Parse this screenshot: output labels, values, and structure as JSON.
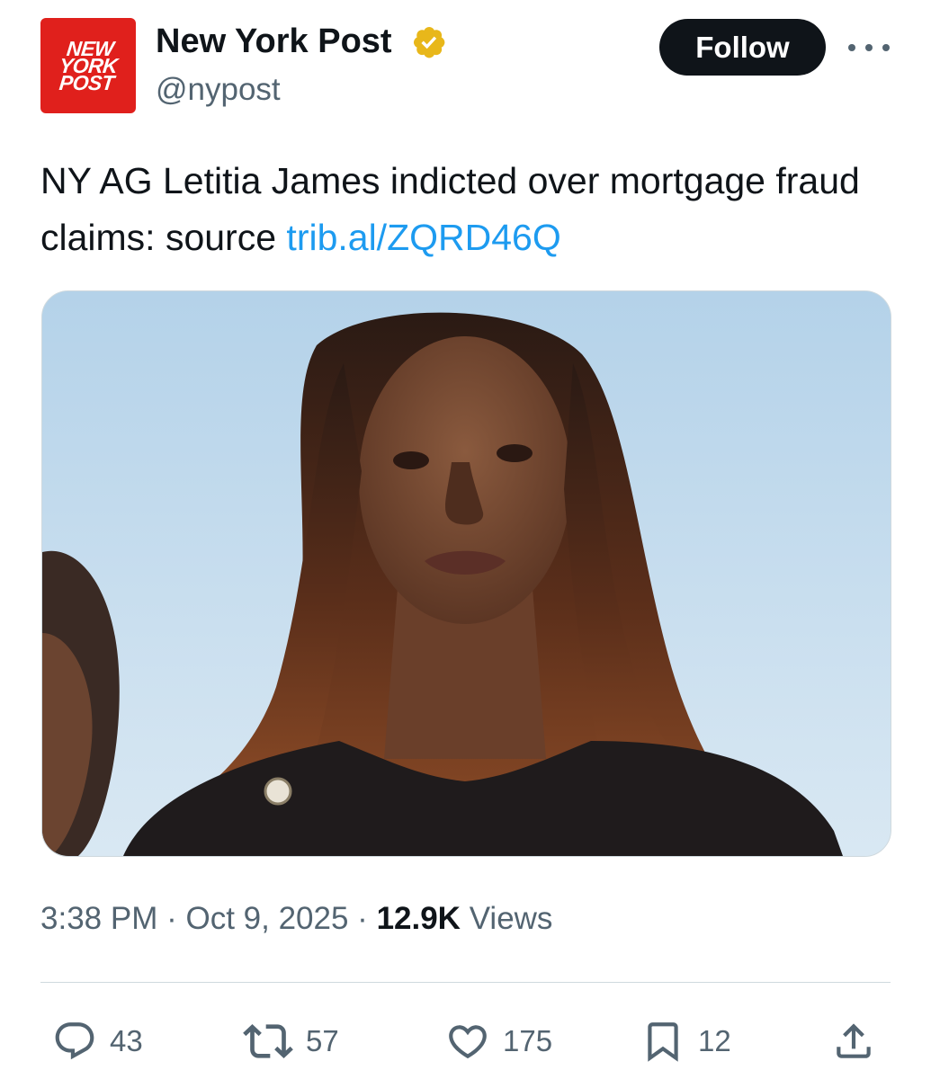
{
  "account": {
    "display_name": "New York Post",
    "handle": "@nypost",
    "avatar_text": [
      "NEW",
      "YORK",
      "POST"
    ],
    "avatar_color": "#e0201c",
    "verified_badge_color": "#e8b71a"
  },
  "follow_button": {
    "label": "Follow"
  },
  "tweet": {
    "text": "NY AG Letitia James indicted over mortgage fraud claims: source ",
    "link": "trib.al/ZQRD46Q",
    "link_color": "#1d9bf0"
  },
  "meta": {
    "time": "3:38 PM",
    "separator": "·",
    "date": "Oct 9, 2025",
    "views_count": "12.9K",
    "views_label": "Views"
  },
  "actions": {
    "replies": "43",
    "reposts": "57",
    "likes": "175",
    "bookmarks": "12"
  },
  "icons": {
    "reply": "reply-icon",
    "repost": "repost-icon",
    "like": "heart-icon",
    "bookmark": "bookmark-icon",
    "share": "share-icon",
    "more": "more-dots-icon",
    "verified": "verified-badge-icon"
  }
}
